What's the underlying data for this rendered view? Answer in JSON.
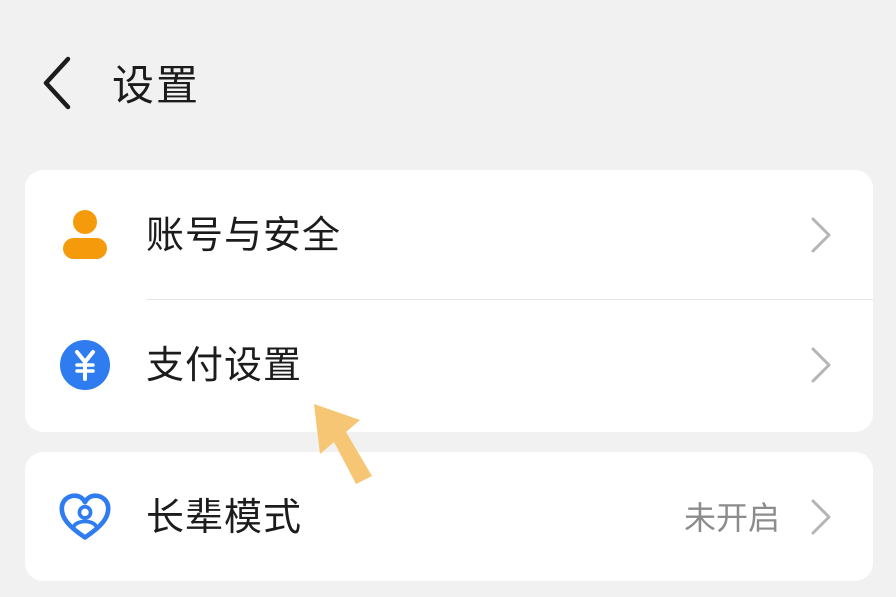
{
  "header": {
    "title": "设置",
    "back_icon": "chevron-left-icon"
  },
  "groups": [
    {
      "items": [
        {
          "label": "账号与安全",
          "icon": "account-icon",
          "icon_color": "#f59a0b"
        },
        {
          "label": "支付设置",
          "icon": "yuan-payment-icon",
          "icon_color": "#2f7cf0"
        }
      ]
    },
    {
      "items": [
        {
          "label": "长辈模式",
          "value": "未开启",
          "icon": "heart-elder-icon",
          "icon_color": "#2f7cf0"
        }
      ]
    }
  ],
  "colors": {
    "background": "#f1f1f1",
    "card": "#ffffff",
    "text": "#1c1c1c",
    "secondary_text": "#8c8c8c",
    "chevron": "#b5b5b5",
    "pointer_arrow": "#f6c674"
  }
}
